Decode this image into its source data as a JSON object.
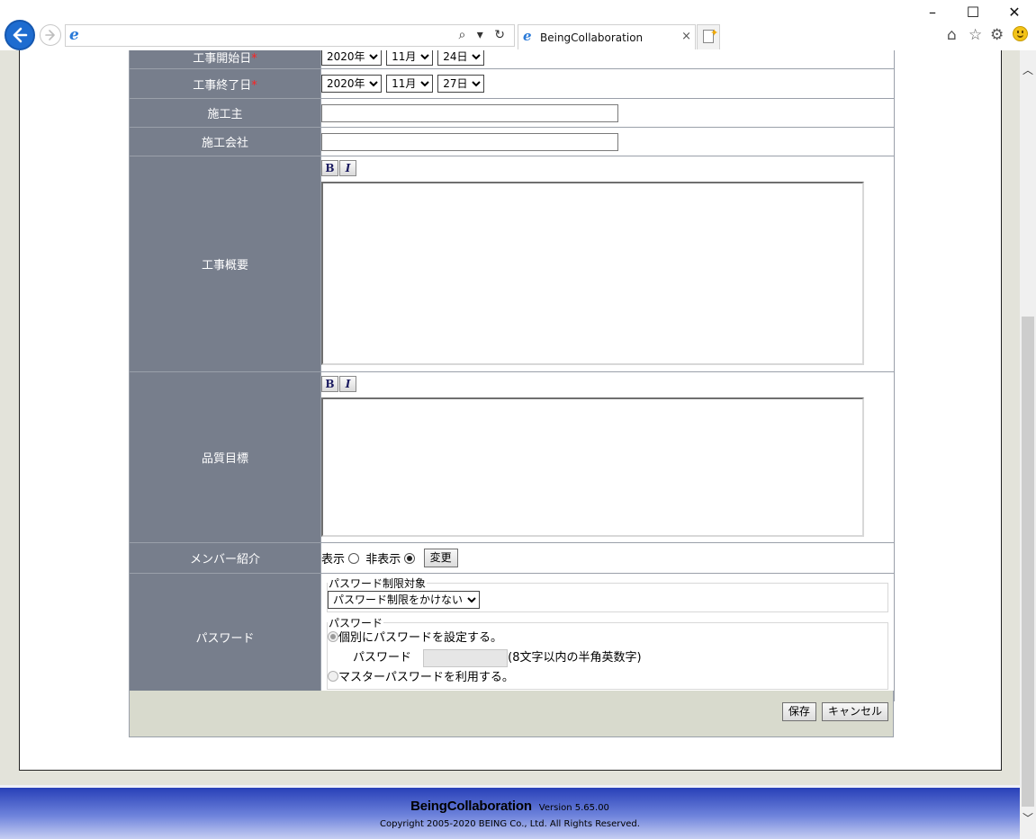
{
  "browser": {
    "address_url": "",
    "address_tools": "⌕ ▾ ↻",
    "tab_title": "BeingCollaboration",
    "tab_close": "×",
    "window": {
      "minimize": "–",
      "maximize": "☐",
      "close": "✕"
    },
    "tools": {
      "home": "⌂",
      "favorites": "☆",
      "settings": "⚙"
    }
  },
  "form": {
    "start_date": {
      "label": "工事開始日",
      "required_mark": "*",
      "year": "2020年",
      "month": "11月",
      "day": "24日"
    },
    "end_date": {
      "label": "工事終了日",
      "required_mark": "*",
      "year": "2020年",
      "month": "11月",
      "day": "27日"
    },
    "owner": {
      "label": "施工主",
      "value": ""
    },
    "company": {
      "label": "施工会社",
      "value": ""
    },
    "summary": {
      "label": "工事概要",
      "bold": "B",
      "italic": "I",
      "value": ""
    },
    "quality": {
      "label": "品質目標",
      "bold": "B",
      "italic": "I",
      "value": ""
    },
    "members": {
      "label": "メンバー紹介",
      "show": "表示",
      "hide": "非表示",
      "selected": "hide",
      "change_button": "変更"
    },
    "password": {
      "label": "パスワード",
      "restriction_legend": "パスワード制限対象",
      "restriction_value": "パスワード制限をかけない",
      "password_legend": "パスワード",
      "option_individual": "個別にパスワードを設定する。",
      "field_label": "パスワード",
      "field_hint": "(8文字以内の半角英数字)",
      "option_master": "マスターパスワードを利用する。"
    }
  },
  "actions": {
    "save": "保存",
    "cancel": "キャンセル"
  },
  "footer": {
    "brand": "BeingCollaboration",
    "version": "Version 5.65.00",
    "copyright": "Copyright 2005-2020 BEING Co., Ltd. All Rights Reserved."
  },
  "colors": {
    "label_bg": "#777e8c",
    "footer_blue": "#2840b8",
    "required": "#ff2020",
    "page_bg": "#e3e3da"
  }
}
